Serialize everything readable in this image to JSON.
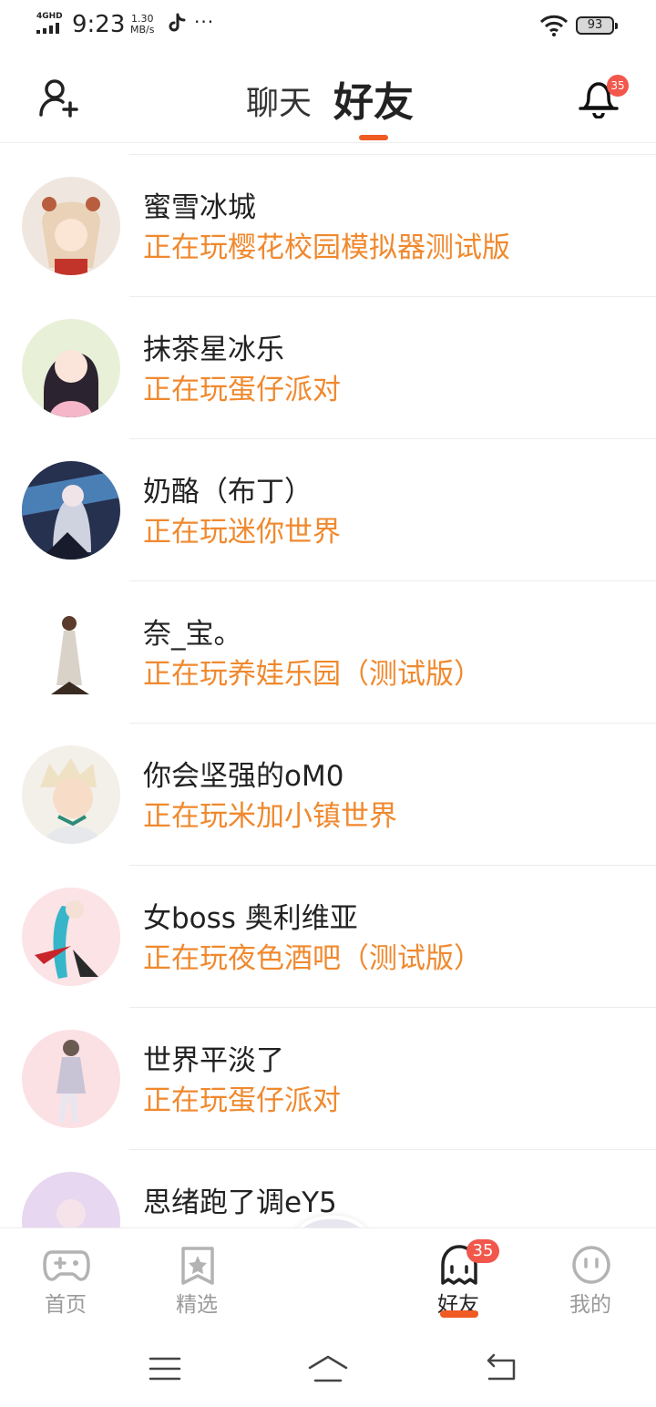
{
  "status_bar": {
    "network": "4GHD",
    "time": "9:23",
    "speed_value": "1.30",
    "speed_unit": "MB/s",
    "more": "···",
    "battery": "93"
  },
  "header": {
    "tabs": [
      {
        "label": "聊天",
        "active": false
      },
      {
        "label": "好友",
        "active": true
      }
    ],
    "notification_count": "35"
  },
  "friends": [
    {
      "name": "蜜雪冰城",
      "status": "正在玩樱花校园模拟器测试版"
    },
    {
      "name": "抹茶星冰乐",
      "status": "正在玩蛋仔派对"
    },
    {
      "name": "奶酪（布丁）",
      "status": "正在玩迷你世界"
    },
    {
      "name": "奈_宝。",
      "status": "正在玩养娃乐园（测试版）"
    },
    {
      "name": "你会坚强的oM0",
      "status": "正在玩米加小镇世界"
    },
    {
      "name": "女boss 奥利维亚",
      "status": "正在玩夜色酒吧（测试版）"
    },
    {
      "name": "世界平淡了",
      "status": "正在玩蛋仔派对"
    },
    {
      "name": "思绪跑了调eY5",
      "status": ""
    }
  ],
  "bottom_nav": {
    "items": [
      {
        "label": "首页",
        "icon": "gamepad-icon",
        "active": false
      },
      {
        "label": "精选",
        "icon": "star-bookmark-icon",
        "active": false
      },
      {
        "label": "好友",
        "icon": "ghost-icon",
        "active": true,
        "badge": "35"
      },
      {
        "label": "我的",
        "icon": "smiley-icon",
        "active": false
      }
    ]
  },
  "colors": {
    "accent": "#f05a23",
    "status_text": "#f0892e",
    "badge": "#f2574b"
  }
}
